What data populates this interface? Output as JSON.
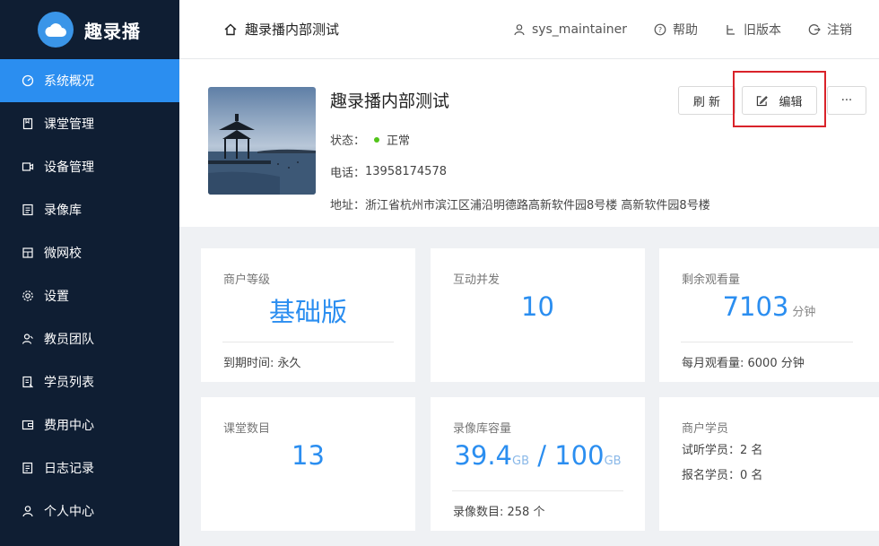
{
  "app": {
    "name": "趣录播"
  },
  "sidebar": {
    "items": [
      {
        "label": "系统概况",
        "icon": "dashboard-icon",
        "active": true
      },
      {
        "label": "课堂管理",
        "icon": "book-icon"
      },
      {
        "label": "设备管理",
        "icon": "video-icon"
      },
      {
        "label": "录像库",
        "icon": "list-icon"
      },
      {
        "label": "微网校",
        "icon": "school-icon"
      },
      {
        "label": "设置",
        "icon": "gear-icon"
      },
      {
        "label": "教员团队",
        "icon": "team-icon"
      },
      {
        "label": "学员列表",
        "icon": "students-icon"
      },
      {
        "label": "费用中心",
        "icon": "wallet-icon"
      },
      {
        "label": "日志记录",
        "icon": "log-icon"
      },
      {
        "label": "个人中心",
        "icon": "user-icon"
      }
    ]
  },
  "header": {
    "breadcrumb": "趣录播内部测试",
    "user": "sys_maintainer",
    "help": "帮助",
    "old_version": "旧版本",
    "logout": "注销"
  },
  "shop": {
    "title": "趣录播内部测试",
    "status_label": "状态：",
    "status_value": "正常",
    "phone_label": "电话：",
    "phone_value": "13958174578",
    "address_label": "地址：",
    "address_value": "浙江省杭州市滨江区浦沿明德路高新软件园8号楼 高新软件园8号楼",
    "refresh_label": "刷 新",
    "edit_label": "编辑",
    "more_label": "···",
    "status_color": "#52c41a"
  },
  "stats": {
    "level": {
      "label": "商户等级",
      "value": "基础版",
      "foot": "到期时间: 永久"
    },
    "concurrency": {
      "label": "互动并发",
      "value": "10"
    },
    "remaining": {
      "label": "剩余观看量",
      "value": "7103",
      "unit": "分钟",
      "foot": "每月观看量: 6000 分钟"
    },
    "classes": {
      "label": "课堂数目",
      "value": "13"
    },
    "storage": {
      "label": "录像库容量",
      "used": "39.4",
      "used_unit": "GB",
      "separator": "/",
      "total": "100",
      "total_unit": "GB",
      "foot": "录像数目: 258 个"
    },
    "members": {
      "label": "商户学员",
      "trial": "试听学员：2 名",
      "enrolled": "报名学员：0 名"
    }
  },
  "colors": {
    "accent": "#2b8ef0",
    "sidebar_bg": "#0f1e33",
    "highlight": "#d9232a"
  }
}
